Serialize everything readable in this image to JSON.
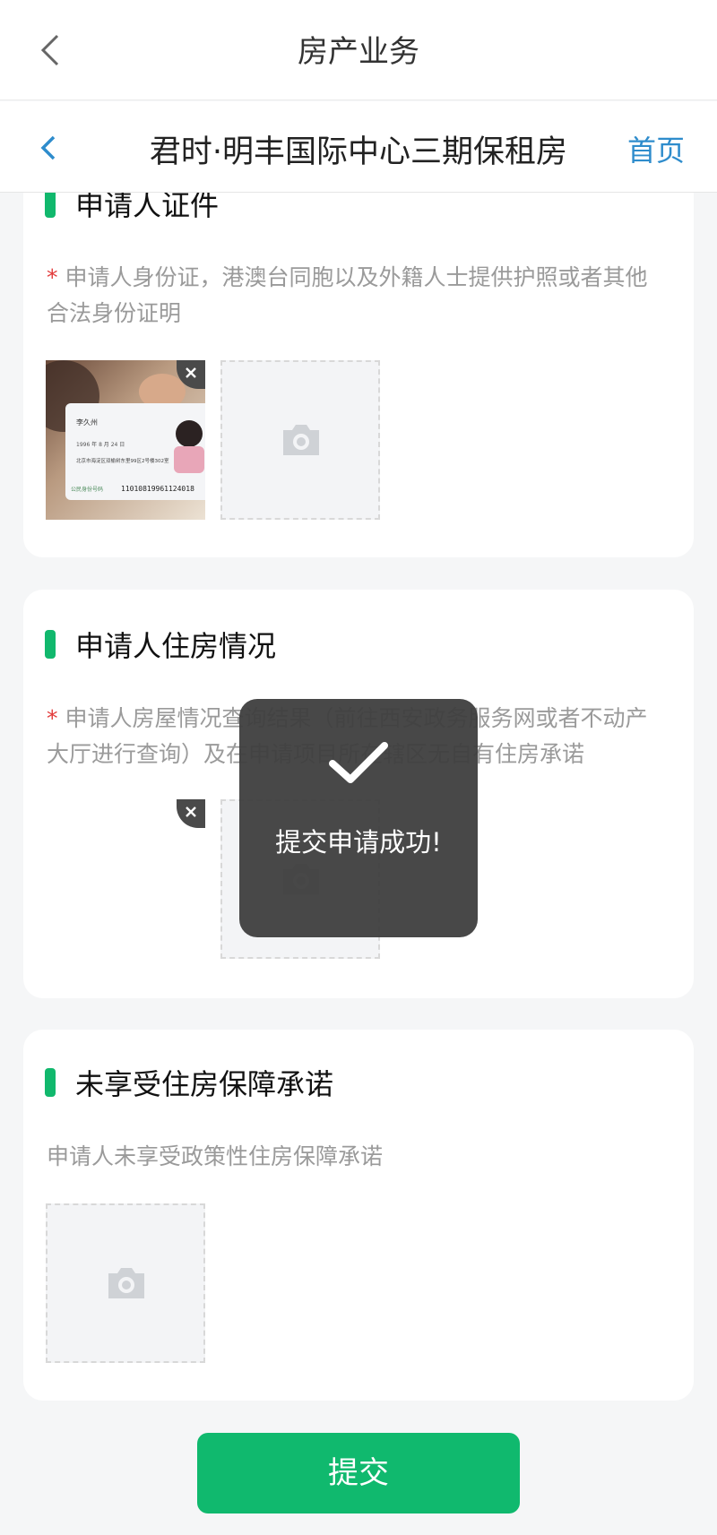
{
  "app_bar": {
    "title": "房产业务",
    "back_icon": "chevron-left-icon"
  },
  "sub_bar": {
    "title": "君时·明丰国际中心三期保租房",
    "home_label": "首页",
    "back_icon": "chevron-left-icon"
  },
  "sections": [
    {
      "title": "申请人证件",
      "required": true,
      "required_mark": "*",
      "description": "申请人身份证，港澳台同胞以及外籍人士提供护照或者其他合法身份证明",
      "uploaded_image": {
        "name": "李久州",
        "birth": "1996 年 8 月 24 日",
        "address": "北京市海淀区双榆树东里99区2号楼302室",
        "id_label": "公民身份号码",
        "id_number": "11010819961124018"
      },
      "upload_placeholder_icon": "camera-icon"
    },
    {
      "title": "申请人住房情况",
      "required": true,
      "required_mark": "*",
      "description": "申请人房屋情况查询结果（前往西安政务服务网或者不动产大厅进行查询）及在申请项目所在辖区无自有住房承诺",
      "upload_placeholder_icon": "camera-icon"
    },
    {
      "title": "未享受住房保障承诺",
      "required": false,
      "description": "申请人未享受政策性住房保障承诺",
      "upload_placeholder_icon": "camera-icon"
    }
  ],
  "delete_icon": "close-icon",
  "submit_label": "提交",
  "toast": {
    "message": "提交申请成功!",
    "icon": "checkmark-icon"
  },
  "colors": {
    "accent": "#10b96e",
    "link": "#2e8ccc",
    "required": "#e23a3a"
  }
}
